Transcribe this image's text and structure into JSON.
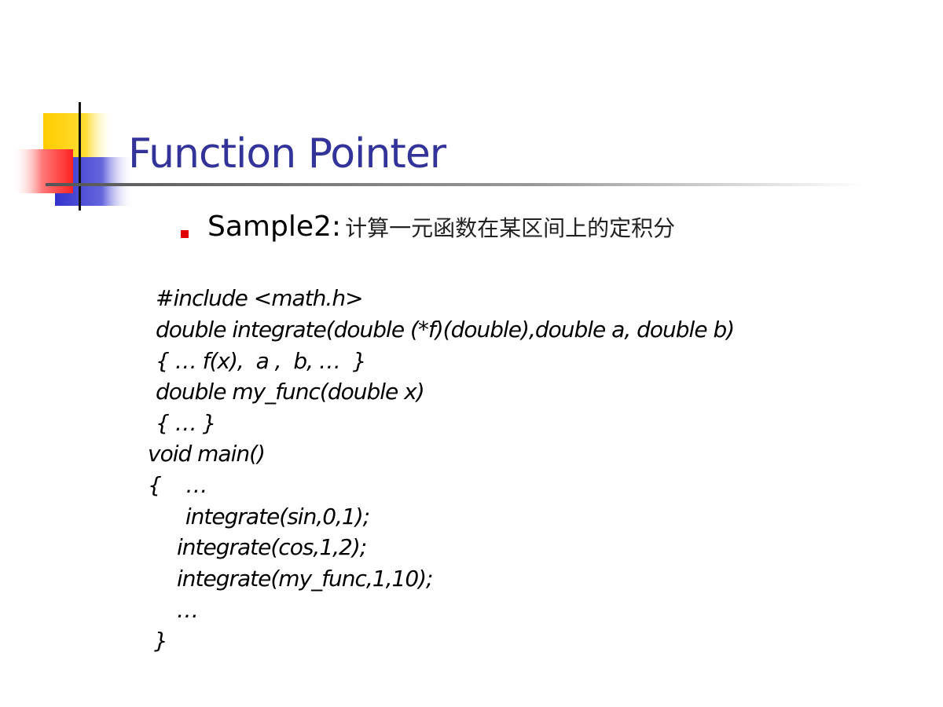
{
  "slide": {
    "title": "Function Pointer",
    "bullet": {
      "label": "Sample2:",
      "description": "计算一元函数在某区间上的定积分"
    },
    "code_lines": [
      "#include <math.h>",
      "double integrate(double (*f)(double),double a, double b)",
      "{ … f(x),  a ,  b, …  }",
      "double my_func(double x)",
      "{ … }",
      "void main()",
      "{    …",
      " integrate(sin,0,1);",
      "integrate(cos,1,2);",
      "integrate(my_func,1,10);",
      "…",
      "}"
    ]
  },
  "colors": {
    "title": "#333399",
    "bullet_marker": "#e00000",
    "deco_yellow": "#ffcc00",
    "deco_red": "#ff3333",
    "deco_blue": "#3333cc"
  }
}
